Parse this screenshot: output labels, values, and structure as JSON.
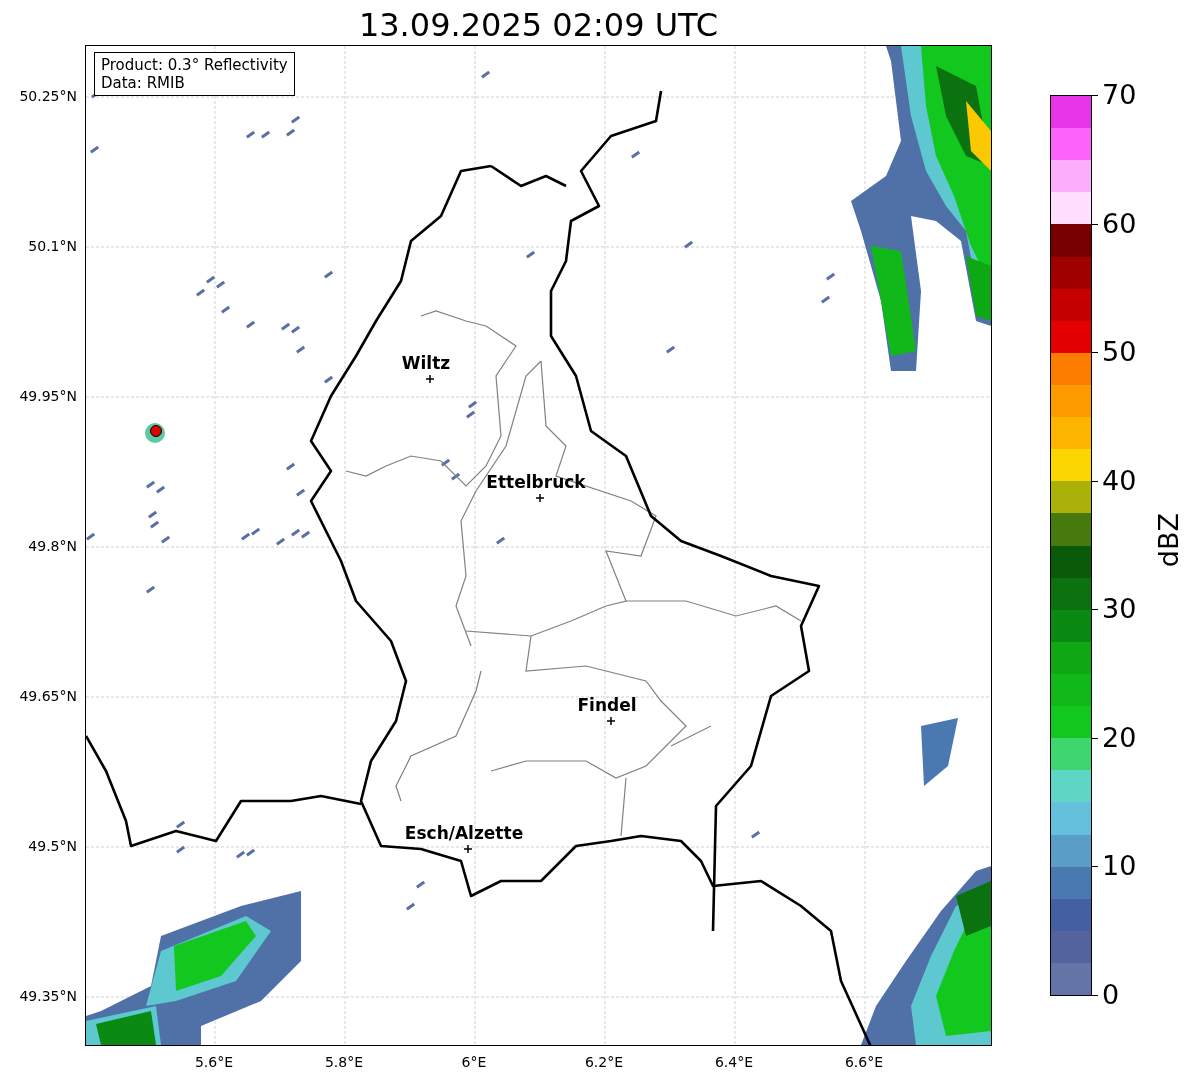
{
  "title": "13.09.2025 02:09 UTC",
  "info_box": {
    "lines": [
      "Product: 0.3° Reflectivity",
      "Data: RMIB"
    ]
  },
  "map": {
    "lat_ticks": [
      "50.25°N",
      "50.1°N",
      "49.95°N",
      "49.8°N",
      "49.65°N",
      "49.5°N",
      "49.35°N"
    ],
    "lon_ticks": [
      "5.6°E",
      "5.8°E",
      "6°E",
      "6.2°E",
      "6.4°E",
      "6.6°E"
    ],
    "cities": [
      {
        "name": "Wiltz"
      },
      {
        "name": "Ettelbruck"
      },
      {
        "name": "Findel"
      },
      {
        "name": "Esch/Alzette"
      }
    ]
  },
  "colorbar": {
    "label": "dBZ",
    "ticks": [
      "70",
      "60",
      "50",
      "40",
      "30",
      "20",
      "10",
      "0"
    ],
    "steps": [
      {
        "color": "#e834e8"
      },
      {
        "color": "#fc64fc"
      },
      {
        "color": "#fcaefc"
      },
      {
        "color": "#fee0fe"
      },
      {
        "color": "#780000"
      },
      {
        "color": "#a00000"
      },
      {
        "color": "#c40000"
      },
      {
        "color": "#e20000"
      },
      {
        "color": "#fc7c00"
      },
      {
        "color": "#fc9a00"
      },
      {
        "color": "#fcb400"
      },
      {
        "color": "#fcd600"
      },
      {
        "color": "#aab20a"
      },
      {
        "color": "#467a0e"
      },
      {
        "color": "#0a5a0a"
      },
      {
        "color": "#0a720e"
      },
      {
        "color": "#0a8a12"
      },
      {
        "color": "#0ea814"
      },
      {
        "color": "#10b81a"
      },
      {
        "color": "#12c81e"
      },
      {
        "color": "#3ed66e"
      },
      {
        "color": "#5ed6c6"
      },
      {
        "color": "#64c0dc"
      },
      {
        "color": "#5a9ec8"
      },
      {
        "color": "#4a78b0"
      },
      {
        "color": "#4560a2"
      },
      {
        "color": "#52639e"
      },
      {
        "color": "#6474a6"
      }
    ]
  }
}
